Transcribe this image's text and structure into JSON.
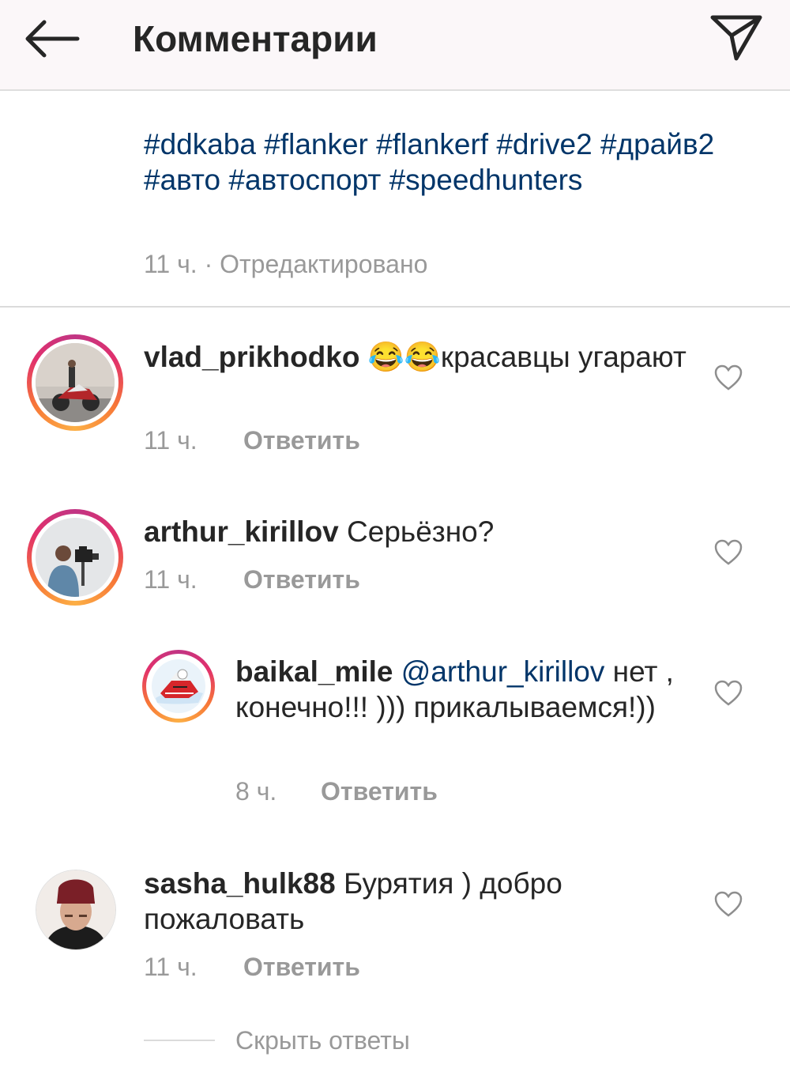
{
  "header": {
    "title": "Комментарии",
    "back_icon": "arrow-left-icon",
    "share_icon": "paper-plane-icon"
  },
  "caption": {
    "text": "#ddkaba #flanker #flankerf #drive2 #драйв2 #авто #автоспорт #speedhunters",
    "time": "11 ч.",
    "separator": " · ",
    "edited": "Отредактировано"
  },
  "comments": [
    {
      "username": "vlad_prikhodko",
      "emoji": "😂😂",
      "text": "красавцы угарают",
      "time": "11 ч.",
      "reply_label": "Ответить"
    },
    {
      "username": "arthur_kirillov",
      "text": "Серьёзно?",
      "time": "11 ч.",
      "reply_label": "Ответить",
      "replies": [
        {
          "username": "baikal_mile",
          "mention": "@arthur_kirillov",
          "text": "нет , конечно!!! ))) прикалываемся!))",
          "time": "8 ч.",
          "reply_label": "Ответить"
        }
      ]
    },
    {
      "username": "sasha_hulk88",
      "text": "Бурятия ) добро пожаловать",
      "time": "11 ч.",
      "reply_label": "Ответить"
    }
  ],
  "hide_replies_label": "Скрыть ответы",
  "colors": {
    "link": "#003569",
    "muted": "#999999",
    "text": "#262626",
    "header_bg": "#fbf7f9"
  }
}
